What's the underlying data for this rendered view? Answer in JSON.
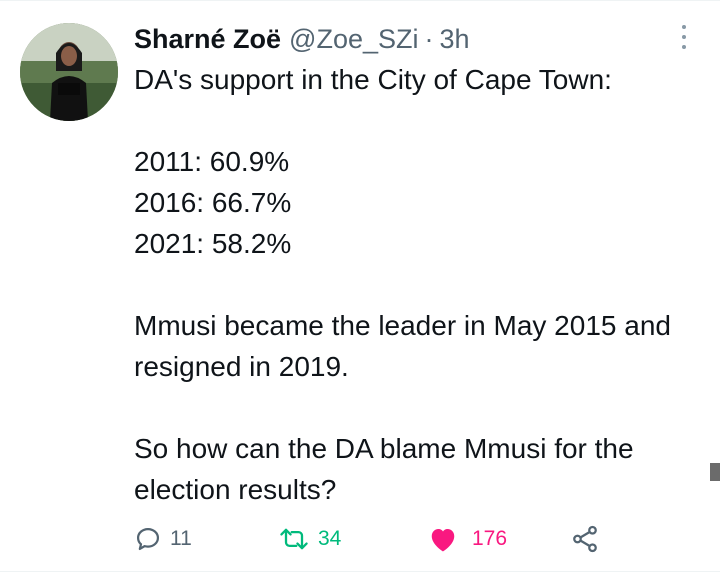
{
  "tweet": {
    "author_name": "Sharné Zoë",
    "handle": "@Zoe_SZi",
    "separator": "·",
    "time": "3h",
    "lines": {
      "intro": "DA's support in the City of Cape Town:",
      "y2011": "2011: 60.9%",
      "y2016": "2016: 66.7%",
      "y2021": "2021: 58.2%",
      "para2": "Mmusi became the leader in May 2015 and resigned in 2019.",
      "para3": "So how can the DA blame Mmusi for the election results?"
    }
  },
  "actions": {
    "reply": {
      "icon": "reply-icon",
      "count": "11",
      "color": "#536471"
    },
    "retweet": {
      "icon": "retweet-icon",
      "count": "34",
      "color": "#00ba7c"
    },
    "like": {
      "icon": "heart-icon",
      "count": "176",
      "color": "#f91880"
    },
    "share": {
      "icon": "share-icon",
      "color": "#536471"
    }
  },
  "colors": {
    "text": "#0f1419",
    "secondary": "#536471",
    "retweet_green": "#00ba7c",
    "like_pink": "#f91880"
  }
}
